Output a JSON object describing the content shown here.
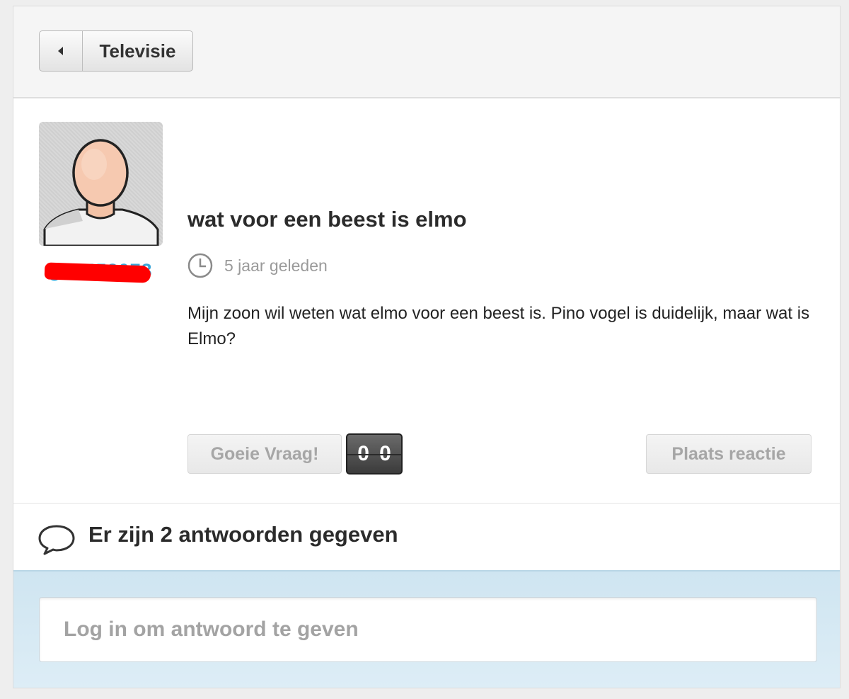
{
  "header": {
    "back_label": "Televisie"
  },
  "question": {
    "username": "ga..452073",
    "title": "wat voor een beest is elmo",
    "time": "5 jaar geleden",
    "body": "Mijn zoon wil weten wat elmo voor een beest is. Pino vogel is duidelijk, maar wat is Elmo?",
    "goeie_vraag_label": "Goeie Vraag!",
    "vote_count_digits": [
      "0",
      "0"
    ],
    "plaats_reactie_label": "Plaats reactie"
  },
  "answers": {
    "count_text": "Er zijn 2 antwoorden gegeven"
  },
  "login": {
    "placeholder": "Log in om antwoord te geven"
  },
  "colors": {
    "link": "#3aa6d8",
    "redaction": "#ff0000",
    "login_band": "#d6e9f3"
  },
  "icons": {
    "back": "left-triangle",
    "time": "clock-icon",
    "answers": "speech-bubble-icon"
  }
}
